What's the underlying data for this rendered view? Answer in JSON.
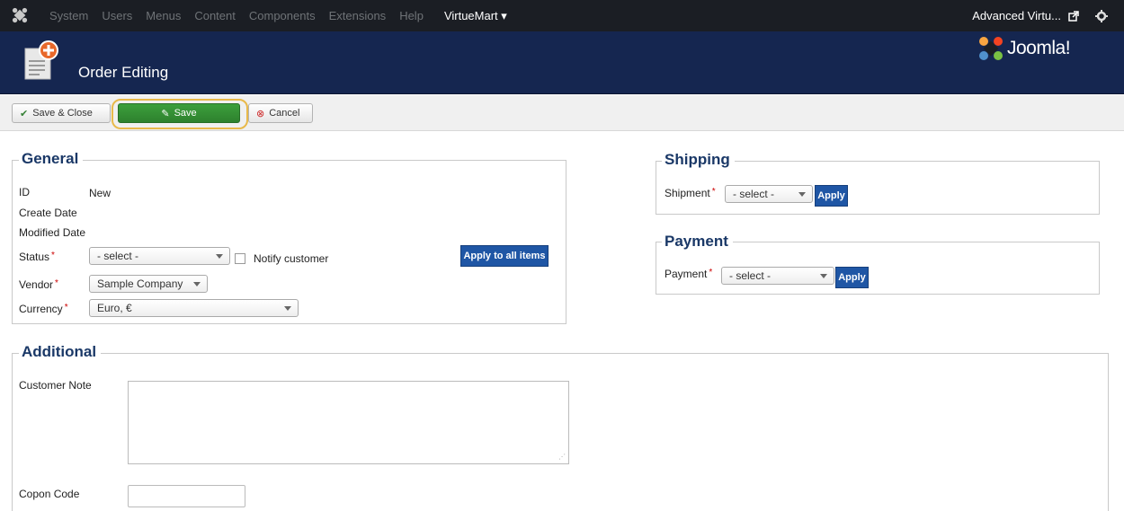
{
  "topnav": {
    "menu": [
      "System",
      "Users",
      "Menus",
      "Content",
      "Components",
      "Extensions",
      "Help"
    ],
    "active_menu": "VirtueMart ▾",
    "site_link": "Advanced Virtu...",
    "icons": [
      "joomla-logo-icon",
      "external-link-icon",
      "gear-icon"
    ]
  },
  "titlebar": {
    "title": "Order Editing",
    "brand": "Joomla!",
    "icons": [
      "order-add-icon",
      "joomla-brand-icon"
    ]
  },
  "toolbar": {
    "save_close_label": "Save & Close",
    "save_label": "Save",
    "cancel_label": "Cancel"
  },
  "general": {
    "legend": "General",
    "id_label": "ID",
    "id_value": "New",
    "create_date_label": "Create Date",
    "modified_date_label": "Modified Date",
    "status_label": "Status",
    "status_value": "- select -",
    "notify_label": "Notify customer",
    "apply_all_label": "Apply to all items",
    "vendor_label": "Vendor",
    "vendor_value": "Sample Company",
    "currency_label": "Currency",
    "currency_value": "Euro, €",
    "required_mark": "*"
  },
  "shipping": {
    "legend": "Shipping",
    "shipment_label": "Shipment",
    "shipment_value": "- select -",
    "apply_label": "Apply"
  },
  "payment": {
    "legend": "Payment",
    "payment_label": "Payment",
    "payment_value": "- select -",
    "apply_label": "Apply"
  },
  "additional": {
    "legend": "Additional",
    "customer_note_label": "Customer Note",
    "coupon_label": "Copon Code"
  },
  "colors": {
    "nav_bg": "#1b1e24",
    "header_bg": "#152650",
    "save_green": "#2e812e",
    "apply_blue": "#1f56a5",
    "legend_blue": "#1a3867",
    "highlight": "#e8b94a"
  }
}
